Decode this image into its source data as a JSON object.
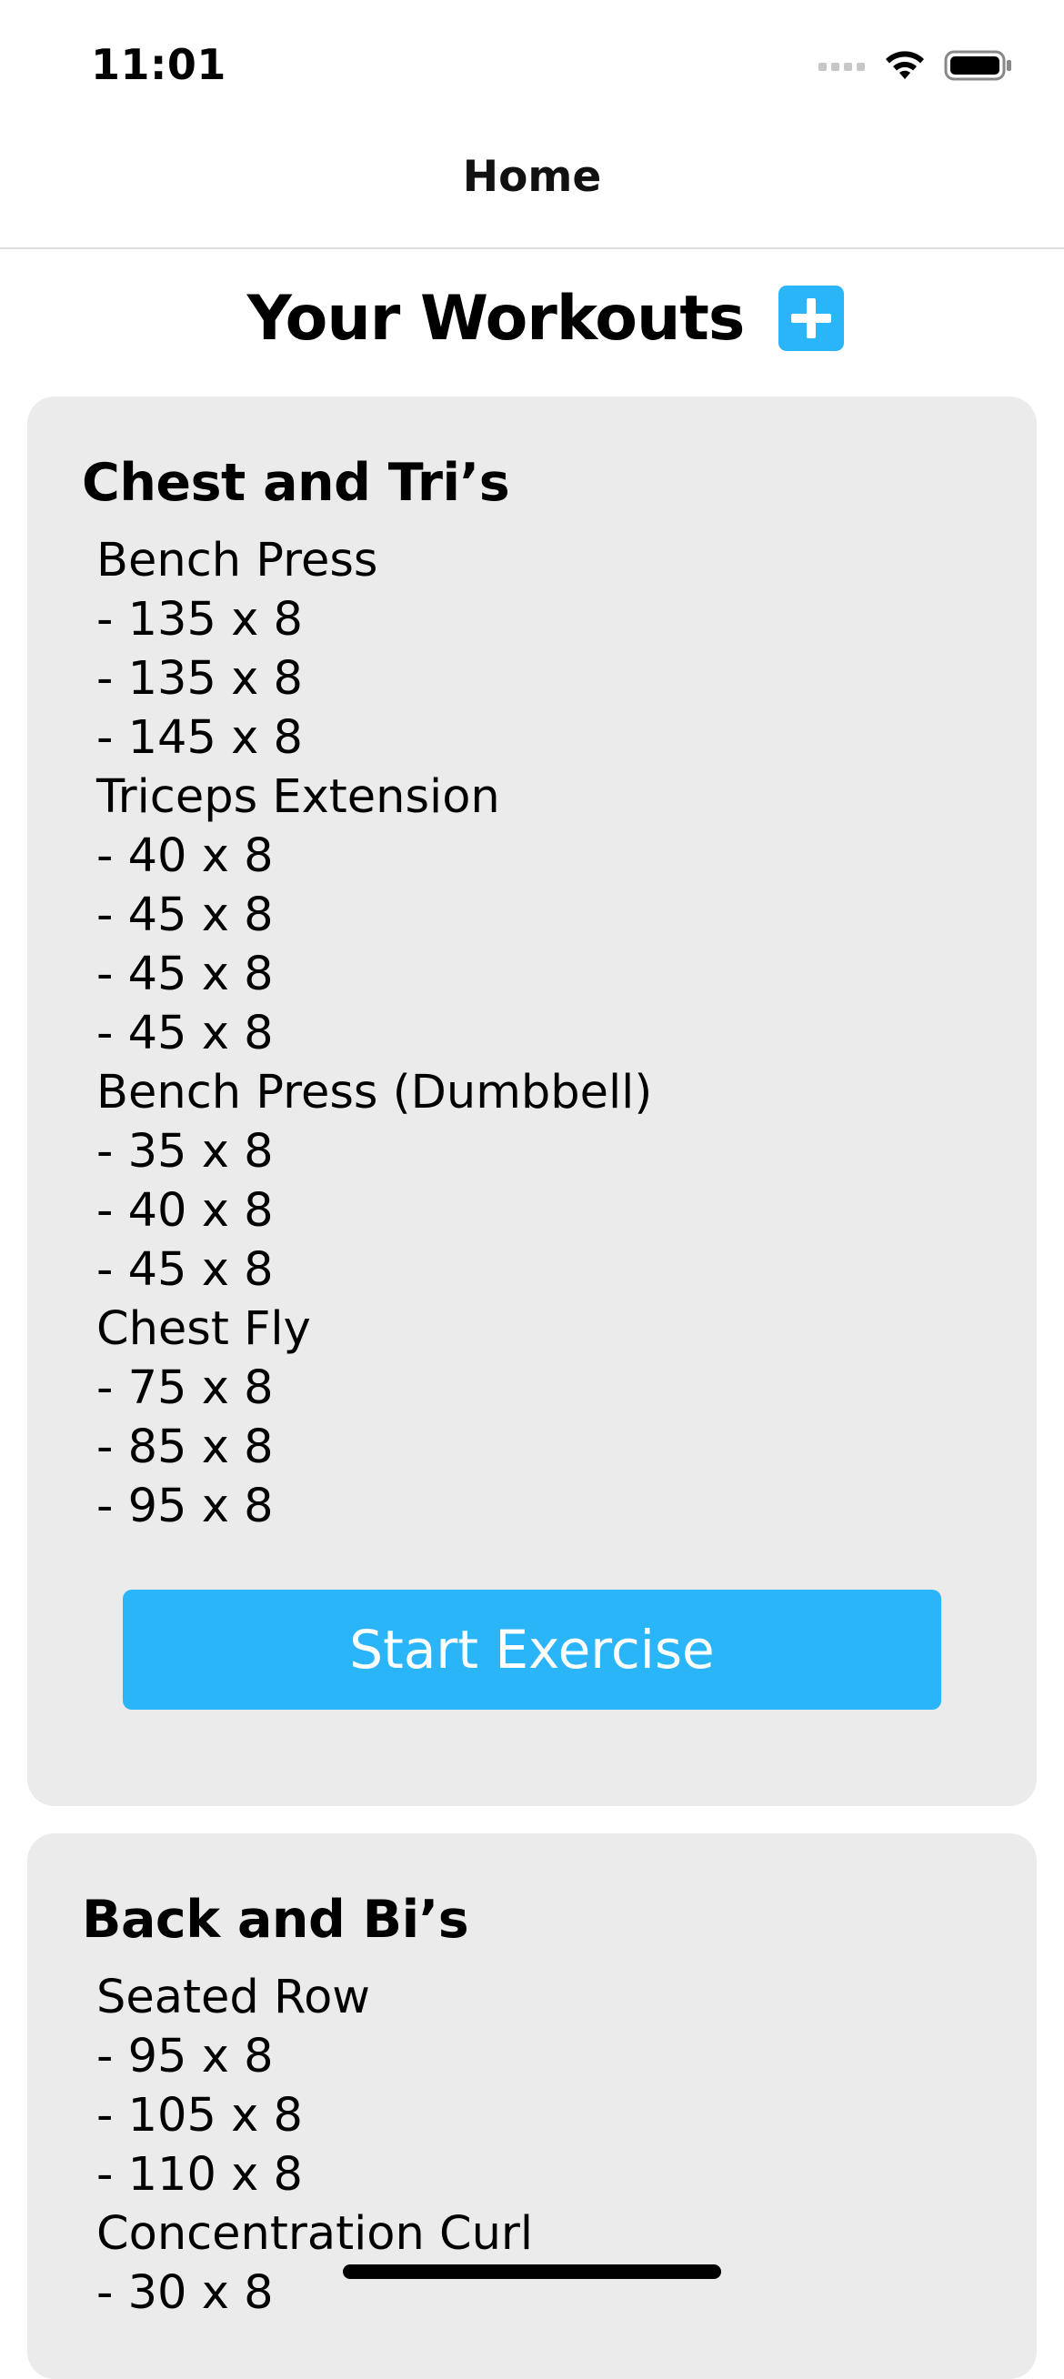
{
  "status_bar": {
    "time": "11:01"
  },
  "nav": {
    "title": "Home"
  },
  "header": {
    "title": "Your Workouts",
    "add_icon": "plus-icon",
    "accent_color": "#2ab5f8"
  },
  "workouts": [
    {
      "title": "Chest and Tri’s",
      "lines": [
        "Bench Press",
        "- 135 x 8",
        "- 135 x 8",
        "- 145 x 8",
        "Triceps Extension",
        "- 40 x 8",
        "- 45 x 8",
        "- 45 x 8",
        "- 45 x 8",
        "Bench Press (Dumbbell)",
        "- 35 x 8",
        "- 40 x 8",
        "- 45 x 8",
        "Chest Fly",
        "- 75 x 8",
        "- 85 x 8",
        "- 95 x 8"
      ],
      "start_label": "Start Exercise"
    },
    {
      "title": "Back and Bi’s",
      "lines": [
        "Seated Row",
        "- 95 x 8",
        "- 105 x 8",
        "- 110 x 8",
        "Concentration Curl",
        "- 30 x 8"
      ]
    }
  ]
}
